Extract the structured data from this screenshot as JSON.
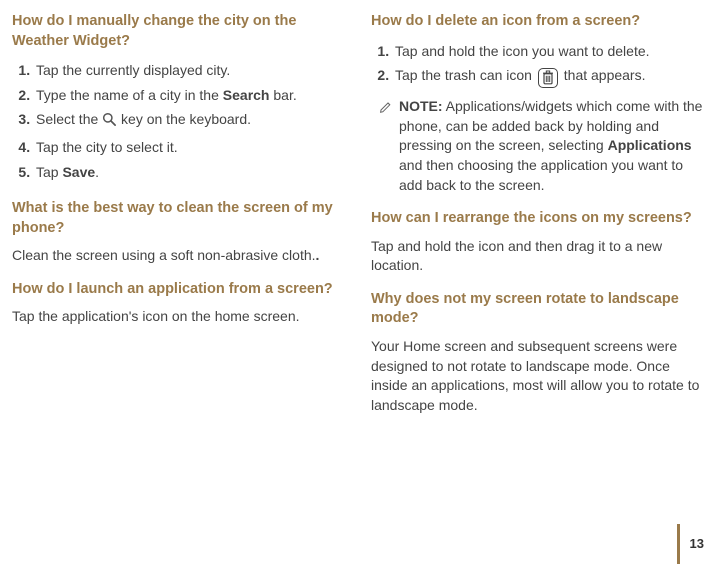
{
  "page_number": "13",
  "left": {
    "s1": {
      "heading": "How do I manually change the city on the Weather Widget?",
      "items": [
        {
          "pre": "Tap the currently displayed city."
        },
        {
          "pre": "Type the name of a city in the ",
          "bold": "Search",
          "post": " bar."
        },
        {
          "pre": "Select the  ",
          "icon": "search",
          "post": " key on the keyboard."
        },
        {
          "pre": "Tap the city to select it."
        },
        {
          "pre": "Tap ",
          "bold": "Save",
          "post": "."
        }
      ]
    },
    "s2": {
      "heading": "What is the best way to clean the screen of my phone?",
      "body": "Clean the screen using a soft non-abrasive cloth."
    },
    "s3": {
      "heading": "How do I launch an application from a screen?",
      "body": "Tap the application's icon on the home screen."
    }
  },
  "right": {
    "s1": {
      "heading": "How do I delete an icon from a screen?",
      "items": [
        {
          "pre": "Tap and hold the icon you want to delete."
        },
        {
          "pre": "Tap the trash can icon ",
          "icon": "trash",
          "post": " that appears."
        }
      ],
      "note_label": "NOTE:",
      "note_pre": " Applications/widgets which come with the phone, can be added back by holding and pressing on the screen, selecting ",
      "note_bold": "Applications",
      "note_post": " and then choosing the application you want to add back to the screen."
    },
    "s2": {
      "heading": "How can I rearrange the icons on my screens?",
      "body": "Tap and hold the icon and then drag it to a new location."
    },
    "s3": {
      "heading": "Why does not my screen rotate to landscape mode?",
      "body": "Your Home screen and subsequent screens were designed to not rotate to landscape mode. Once inside an applications, most will allow you to rotate to landscape mode."
    }
  }
}
